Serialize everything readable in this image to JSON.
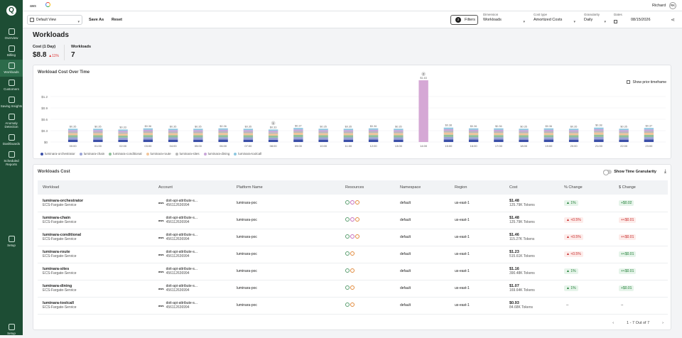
{
  "sidebar": {
    "items": [
      {
        "label": "Overview",
        "icon": "home-icon"
      },
      {
        "label": "Billing",
        "icon": "billing-icon"
      },
      {
        "label": "Workloads",
        "icon": "workloads-icon",
        "active": true
      },
      {
        "label": "Customers",
        "icon": "customers-icon"
      },
      {
        "label": "Saving Insights",
        "icon": "insights-icon"
      },
      {
        "label": "Anomaly Detection",
        "icon": "anomaly-icon"
      },
      {
        "label": "Dashboards",
        "icon": "dashboards-icon"
      },
      {
        "label": "Scheduled Reports",
        "icon": "reports-icon"
      }
    ],
    "setup_label": "Setup",
    "setup2_label": "Setup"
  },
  "topbar": {
    "tab_aws": "aws",
    "user_name": "Richard",
    "user_initials": "RK"
  },
  "filters": {
    "view": "Default View",
    "save_as": "Save As",
    "reset": "Reset",
    "filters_label": "Filters",
    "filters_count": "2",
    "dimension_caption": "Dimension",
    "dimension_value": "Workloads",
    "cost_type_caption": "Cost type",
    "cost_type_value": "Amortized Costs",
    "granularity_caption": "Granularity",
    "granularity_value": "Daily",
    "dates_caption": "Dates",
    "dates_value": "08/15/2026"
  },
  "page": {
    "title": "Workloads"
  },
  "kpis": {
    "cost_title": "Cost (1 Day)",
    "cost_value": "$8.8",
    "cost_delta": "11%",
    "workloads_title": "Workloads",
    "workloads_value": "7"
  },
  "chart_card": {
    "title": "Workload Cost Over Time",
    "prior_label": "Show prior timeframe"
  },
  "chart_data": {
    "type": "bar",
    "stacked": true,
    "categories": [
      "00:00",
      "01:00",
      "02:00",
      "03:00",
      "04:00",
      "05:00",
      "06:00",
      "07:00",
      "08:00",
      "09:00",
      "10:00",
      "11:00",
      "12:00",
      "13:00",
      "14:00",
      "15:00",
      "16:00",
      "17:00",
      "18:00",
      "19:00",
      "20:00",
      "21:00",
      "22:00",
      "23:00"
    ],
    "totals": [
      0.35,
      0.35,
      0.33,
      0.36,
      0.35,
      0.35,
      0.36,
      0.35,
      0.33,
      0.37,
      0.35,
      0.35,
      0.36,
      0.35,
      1.63,
      0.38,
      0.36,
      0.36,
      0.35,
      0.36,
      0.35,
      0.38,
      0.35,
      0.37
    ],
    "total_labels": [
      "$0.35",
      "$0.35",
      "$0.33",
      "$0.36",
      "$0.35",
      "$0.35",
      "$0.36",
      "$0.35",
      "$0.33",
      "$0.37",
      "$0.35",
      "$0.35",
      "$0.36",
      "$0.35",
      "$1.63",
      "$0.38",
      "$0.36",
      "$0.36",
      "$0.35",
      "$0.36",
      "$0.35",
      "$0.38",
      "$0.35",
      "$0.37"
    ],
    "yticks": [
      "$1.2",
      "$0.9",
      "$0.6",
      "$0.3",
      "$0"
    ],
    "ylim": [
      0,
      1.2
    ],
    "series": [
      {
        "name": "luminara-orchestrator",
        "color": "#3b4fa8"
      },
      {
        "name": "luminara-chain",
        "color": "#9aa3d6"
      },
      {
        "name": "luminara-conditional",
        "color": "#8fbf9a"
      },
      {
        "name": "luminara-route",
        "color": "#f2c59a"
      },
      {
        "name": "luminara-sites",
        "color": "#b8b8b8"
      },
      {
        "name": "luminara-dining",
        "color": "#c8a5d8"
      },
      {
        "name": "luminara-toolcall",
        "color": "#8cc7e0"
      }
    ],
    "annotations": [
      "1",
      "2"
    ]
  },
  "table_card": {
    "title": "Workloads Cost",
    "toggle_label": "Show Time Granularity"
  },
  "table": {
    "headers": [
      "Workload",
      "Account",
      "Platform Name",
      "Resources",
      "Namespace",
      "Region",
      "Cost",
      "% Change",
      "$ Change"
    ],
    "rows": [
      {
        "name": "luminara-orchestrator",
        "type": "ECS-Fargate-Service",
        "account": "doit-api-attribute-s...",
        "account_id": "456112636994",
        "platform": "luminara-poc",
        "namespace": "default",
        "region": "us-east-1",
        "cost": "$1.48",
        "tokens": "125.79K Tokens",
        "pct": "1%",
        "dollar": "$0.02"
      },
      {
        "name": "luminara-chain",
        "type": "ECS-Fargate-Service",
        "account": "doit-api-attribute-s...",
        "account_id": "456112636994",
        "platform": "luminara-poc",
        "namespace": "default",
        "region": "us-east-1",
        "cost": "$1.48",
        "tokens": "125.79K Tokens",
        "pct": "<0.5%",
        "dollar": "<$0.01"
      },
      {
        "name": "luminara-conditional",
        "type": "ECS-Fargate-Service",
        "account": "doit-api-attribute-s...",
        "account_id": "456112636994",
        "platform": "luminara-poc",
        "namespace": "default",
        "region": "us-east-1",
        "cost": "$1.46",
        "tokens": "115.27K Tokens",
        "pct": "<0.5%",
        "dollar": "<$0.01"
      },
      {
        "name": "luminara-route",
        "type": "ECS-Fargate-Service",
        "account": "doit-api-attribute-s...",
        "account_id": "456112636994",
        "platform": "luminara-poc",
        "namespace": "default",
        "region": "us-east-1",
        "cost": "$1.23",
        "tokens": "515.61K Tokens",
        "pct": "<0.5%",
        "dollar": "<$0.01"
      },
      {
        "name": "luminara-sites",
        "type": "ECS-Fargate-Service",
        "account": "doit-api-attribute-s...",
        "account_id": "456112636994",
        "platform": "luminara-poc",
        "namespace": "default",
        "region": "us-east-1",
        "cost": "$1.16",
        "tokens": "390.48K Tokens",
        "pct": "1%",
        "dollar": "<$0.01"
      },
      {
        "name": "luminara-dining",
        "type": "ECS-Fargate-Service",
        "account": "doit-api-attribute-s...",
        "account_id": "456112636994",
        "platform": "luminara-poc",
        "namespace": "default",
        "region": "us-east-1",
        "cost": "$1.07",
        "tokens": "169.64K Tokens",
        "pct": "1%",
        "dollar": "$0.01"
      },
      {
        "name": "luminara-toolcall",
        "type": "ECS-Fargate-Service",
        "account": "doit-api-attribute-s...",
        "account_id": "456112636994",
        "platform": "luminara-poc",
        "namespace": "default",
        "region": "us-east-1",
        "cost": "$0.93",
        "tokens": "84.68K Tokens",
        "pct": "--",
        "dollar": "--"
      }
    ]
  },
  "pager": {
    "text": "1 - 7 Out of 7"
  }
}
